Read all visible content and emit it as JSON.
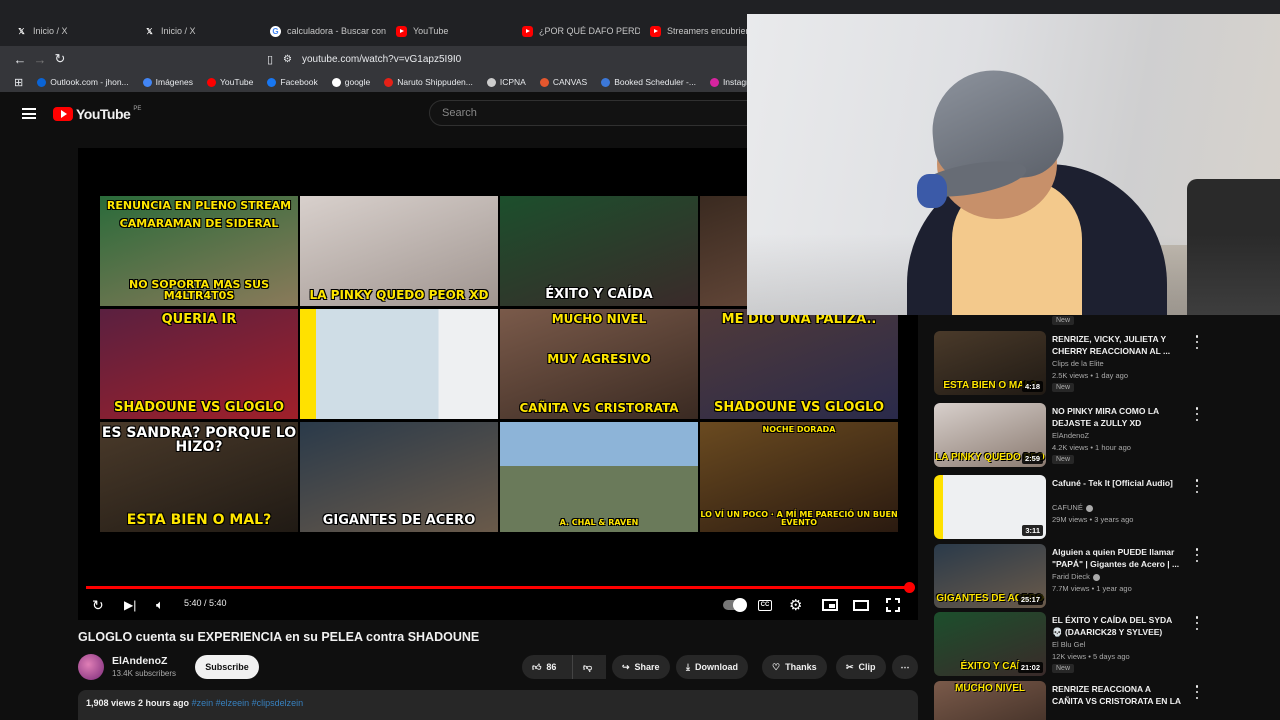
{
  "browser": {
    "tabs": [
      {
        "label": "Inicio / X",
        "icon": "x-logo-icon"
      },
      {
        "label": "Inicio / X",
        "icon": "x-logo-icon"
      },
      {
        "label": "calculadora - Buscar con G",
        "icon": "google-icon"
      },
      {
        "label": "YouTube",
        "icon": "youtube-icon"
      },
      {
        "label": "¿POR QUÉ DAFO PERDIÓ",
        "icon": "youtube-icon"
      },
      {
        "label": "Streamers encubriendo",
        "icon": "youtube-icon"
      }
    ],
    "url": "youtube.com/watch?v=vG1apz5I9I0",
    "bookmarks": [
      {
        "label": "Outlook.com - jhon...",
        "color": "#0a64d6"
      },
      {
        "label": "Imágenes",
        "color": "#4285f4"
      },
      {
        "label": "YouTube",
        "color": "#ff0000"
      },
      {
        "label": "Facebook",
        "color": "#1877f2"
      },
      {
        "label": "google",
        "color": "#ffffff"
      },
      {
        "label": "Naruto Shippuden...",
        "color": "#e62117"
      },
      {
        "label": "ICPNA",
        "color": "#cccccc"
      },
      {
        "label": "CANVAS",
        "color": "#e4572e"
      },
      {
        "label": "Booked Scheduler -...",
        "color": "#3c78d8"
      },
      {
        "label": "Instagram",
        "color": "#d6249f"
      }
    ]
  },
  "masthead": {
    "logo_text": "YouTube",
    "country": "PE",
    "search_placeholder": "Search"
  },
  "player": {
    "time": "5:40 / 5:40",
    "progress": 1.0,
    "cc_label": "CC",
    "endscreen": [
      {
        "top": "RENUNCIA EN PLENO STREAM",
        "mid": "CAMARAMAN DE SIDERAL",
        "bottom": "NO SOPORTA MAS SUS M4LTR4T0S"
      },
      {
        "top": "",
        "mid": "",
        "bottom": "LA PINKY QUEDO PEOR XD"
      },
      {
        "top": "",
        "mid": "",
        "bottom": "ÉXITO Y CAÍDA"
      },
      {
        "top": "",
        "mid": "",
        "bottom": ""
      },
      {
        "top": "QUERIA IR",
        "mid": "",
        "bottom": "SHADOUNE VS GLOGLO"
      },
      {
        "top": "",
        "mid": "",
        "bottom": ""
      },
      {
        "top": "MUCHO NIVEL",
        "mid": "MUY AGRESIVO",
        "bottom": "CAÑITA VS CRISTORATA"
      },
      {
        "top": "ME DIO UNA PALIZA..",
        "mid": "",
        "bottom": "SHADOUNE VS GLOGLO"
      },
      {
        "top": "ES SANDRA? PORQUE LO HIZO?",
        "mid": "",
        "bottom": "ESTA BIEN O MAL?"
      },
      {
        "top": "",
        "mid": "",
        "bottom": "GIGANTES DE ACERO"
      },
      {
        "top": "",
        "mid": "",
        "bottom": "A. CHAL & RAVEN"
      },
      {
        "top": "NOCHE DORADA",
        "mid": "",
        "bottom": "LO VÍ UN POCO · A MÍ ME PARECIÓ UN BUEN EVENTO"
      }
    ]
  },
  "video": {
    "title": "GLOGLO cuenta su EXPERIENCIA en su PELEA contra SHADOUNE",
    "channel": "ElAndenoZ",
    "subscribers": "13.4K subscribers",
    "subscribe_label": "Subscribe",
    "likes": "86",
    "share_label": "Share",
    "download_label": "Download",
    "thanks_label": "Thanks",
    "clip_label": "Clip",
    "views_date": "1,908 views  2 hours ago",
    "hashtags": "#zein #elzeein #clipsdelzein"
  },
  "sidebar": {
    "prev_badge": "New",
    "items": [
      {
        "title": "RENRIZE, VICKY, JULIETA Y CHERRY REACCIONAN AL ...",
        "channel": "Clips de la Elite",
        "meta": "2.5K views • 1 day ago",
        "duration": "4:18",
        "badge": "New",
        "thumb_text": "ESTA BIEN O MAL?"
      },
      {
        "title": "NO PINKY MIRA COMO LA DEJASTE a ZULLY XD",
        "channel": "ElAndenoZ",
        "meta": "4.2K views • 1 hour ago",
        "duration": "2:59",
        "badge": "New",
        "thumb_text": "LA PINKY QUEDO PEO"
      },
      {
        "title": "Cafuné - Tek It [Official Audio]",
        "channel": "CAFUNÉ",
        "meta": "29M views • 3 years ago",
        "duration": "3:11",
        "badge": "",
        "thumb_text": ""
      },
      {
        "title": "Alguien a quien PUEDE llamar \"PAPÁ\" | Gigantes de Acero | ...",
        "channel": "Farid Dieck",
        "meta": "7.7M views • 1 year ago",
        "duration": "25:17",
        "badge": "",
        "thumb_text": "GIGANTES DE ACERO"
      },
      {
        "title": "EL ÉXITO Y CAÍDA DEL SYDA 💀 (DAARICK28 Y SYLVEE)",
        "channel": "El Blu Gel",
        "meta": "12K views • 5 days ago",
        "duration": "21:02",
        "badge": "New",
        "thumb_text": "ÉXITO Y CAÍ"
      },
      {
        "title": "RENRIZE REACCIONA A CAÑITA VS CRISTORATA EN LA NOCH...",
        "channel": "",
        "meta": "",
        "duration": "",
        "badge": "",
        "thumb_text": "MUCHO NIVEL"
      }
    ]
  },
  "colors": {
    "accent": "#ff0000",
    "background": "#0f0f0f",
    "surface": "#272727",
    "link": "#3ea6ff"
  }
}
